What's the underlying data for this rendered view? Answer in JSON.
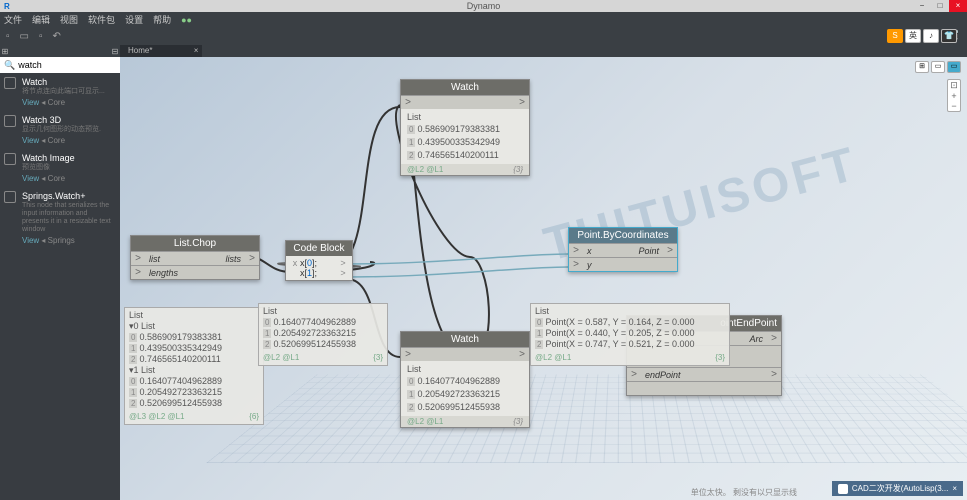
{
  "window": {
    "title": "Dynamo",
    "appIcon": "R"
  },
  "menu": [
    "文件",
    "编辑",
    "视图",
    "软件包",
    "设置",
    "帮助"
  ],
  "toolbarRight": [
    "S",
    "英",
    "♪",
    "T"
  ],
  "tabs": [
    {
      "label": "Home*"
    }
  ],
  "search": {
    "value": "watch",
    "icon": "🔍"
  },
  "searchResults": [
    {
      "title": "Watch",
      "desc": "将节点连向此端口可显示...",
      "view": "View",
      "cat": "Core"
    },
    {
      "title": "Watch 3D",
      "desc": "显示几何图形的动态预览.",
      "view": "View",
      "cat": "Core"
    },
    {
      "title": "Watch Image",
      "desc": "预览图像",
      "view": "View",
      "cat": "Core"
    },
    {
      "title": "Springs.Watch+",
      "desc": "This node that serializes the input information and presents it in a resizable text window",
      "view": "View",
      "cat": "Springs"
    }
  ],
  "nodes": {
    "watch1": {
      "title": "Watch",
      "list": "List",
      "rows": [
        {
          "i": "0",
          "v": "0.586909179383381"
        },
        {
          "i": "1",
          "v": "0.439500335342949"
        },
        {
          "i": "2",
          "v": "0.746565140200111"
        }
      ],
      "foot": "@L2 @L1",
      "count": "{3}"
    },
    "listchop": {
      "title": "List.Chop",
      "in": [
        "list",
        "lengths"
      ],
      "out": [
        "lists"
      ]
    },
    "codeblock": {
      "title": "Code Block",
      "lines": [
        "x[0];",
        "x[1];"
      ],
      "lp": "x",
      "rp": [
        ">",
        ">"
      ]
    },
    "pbc": {
      "title": "Point.ByCoordinates",
      "in": [
        "x",
        "y"
      ],
      "out": [
        "Point"
      ]
    },
    "watch2": {
      "title": "Watch",
      "list": "List",
      "rows": [
        {
          "i": "0",
          "v": "0.164077404962889"
        },
        {
          "i": "1",
          "v": "0.205492723363215"
        },
        {
          "i": "2",
          "v": "0.520699512455938"
        }
      ],
      "foot": "@L2 @L1",
      "count": "{3}"
    },
    "arc": {
      "title": "ointEndPoint",
      "in": [
        "endPoint"
      ],
      "out": [
        "Arc"
      ]
    }
  },
  "previews": {
    "p1": {
      "head": "List",
      "groups": [
        {
          "g": "0 List",
          "rows": [
            {
              "i": "0",
              "v": "0.586909179383381"
            },
            {
              "i": "1",
              "v": "0.439500335342949"
            },
            {
              "i": "2",
              "v": "0.746565140200111"
            }
          ]
        },
        {
          "g": "1 List",
          "rows": [
            {
              "i": "0",
              "v": "0.164077404962889"
            },
            {
              "i": "1",
              "v": "0.205492723363215"
            },
            {
              "i": "2",
              "v": "0.520699512455938"
            }
          ]
        }
      ],
      "foot": "@L3 @L2 @L1",
      "count": "{6}"
    },
    "p2": {
      "head": "List",
      "rows": [
        {
          "i": "0",
          "v": "0.164077404962889"
        },
        {
          "i": "1",
          "v": "0.205492723363215"
        },
        {
          "i": "2",
          "v": "0.520699512455938"
        }
      ],
      "foot": "@L2 @L1",
      "count": "{3}"
    },
    "p3": {
      "head": "List",
      "rows": [
        {
          "i": "0",
          "v": "Point(X = 0.587, Y = 0.164, Z = 0.000"
        },
        {
          "i": "1",
          "v": "Point(X = 0.440, Y = 0.205, Z = 0.000"
        },
        {
          "i": "2",
          "v": "Point(X = 0.747, Y = 0.521, Z = 0.000"
        }
      ],
      "foot": "@L2 @L1",
      "count": "{3}"
    }
  },
  "watermark": "TUITUISOFT",
  "notification": "CAD二次开发(AutoLisp(3...",
  "statusText": "单位太快。 剩没有以只显示线"
}
